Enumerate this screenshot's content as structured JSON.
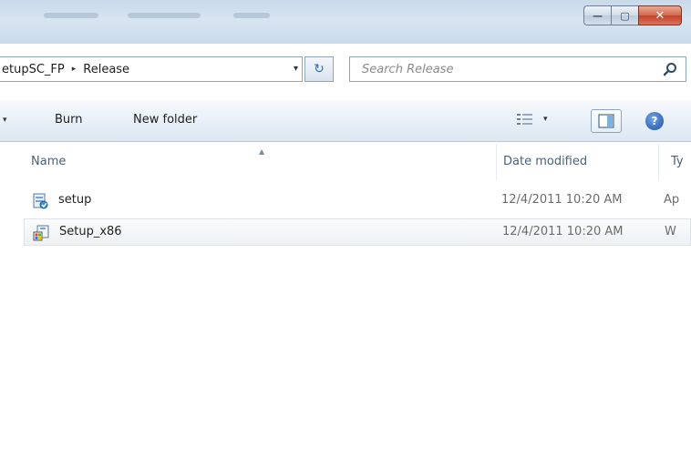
{
  "window": {
    "minimize_glyph": "—",
    "maximize_glyph": "▢",
    "close_glyph": "✕"
  },
  "address": {
    "breadcrumb": [
      "etupSC_FP",
      "Release"
    ],
    "separator": "▸",
    "dropdown_glyph": "▾",
    "refresh_glyph": "↻"
  },
  "search": {
    "placeholder": "Search Release"
  },
  "toolbar": {
    "overflow_glyph": "▾",
    "burn_label": "Burn",
    "new_folder_label": "New folder",
    "view_caret": "▾",
    "help_glyph": "?"
  },
  "columns": {
    "sort_glyph": "▲",
    "name": "Name",
    "date_modified": "Date modified",
    "type": "Ty"
  },
  "files": [
    {
      "name": "setup",
      "date": "12/4/2011 10:20 AM",
      "type": "Ap",
      "icon": "setup-installer-icon"
    },
    {
      "name": "Setup_x86",
      "date": "12/4/2011 10:20 AM",
      "type": "W",
      "icon": "windows-installer-icon"
    }
  ],
  "colors": {
    "accent": "#2c6fb3",
    "close_red": "#c2412a",
    "header_text": "#4c607a"
  }
}
